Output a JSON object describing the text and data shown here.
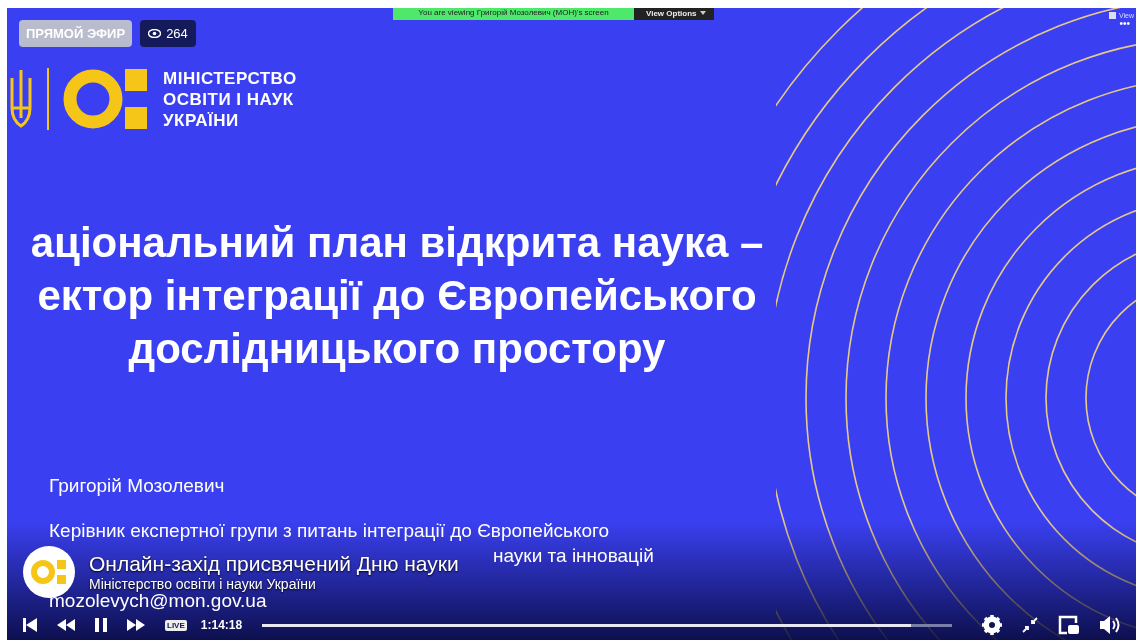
{
  "stream_badges": {
    "live_label": "ПРЯМОЙ ЭФИР",
    "viewers": "264"
  },
  "share_banner": {
    "text": "You are viewing Григорій Мозолевич (МОН)'s screen",
    "button": "View Options"
  },
  "view_menu": {
    "label": "View",
    "more": "•••"
  },
  "slide": {
    "logo_lines": [
      "МІНІСТЕРСТВО",
      "ОСВІТИ І НАУК",
      "УКРАЇНИ"
    ],
    "title_lines": [
      "аціональний план відкрита наука –",
      "ектор інтеграції до Європейського",
      "дослідницького простору"
    ],
    "author": "Григорій Мозолевич",
    "role_line": "Керівник експертної групи з питань інтеграції до Європейського",
    "role_fragments": [
      "науки та інновацій"
    ],
    "email": "mozolevych@mon.gov.ua"
  },
  "stream_info": {
    "title": "Онлайн-захід присвячений Дню науки",
    "page": "Міністерство освіти і науки України"
  },
  "player": {
    "live": "LIVE",
    "time": "1:14:18",
    "progress": {
      "level": 0.94
    }
  }
}
